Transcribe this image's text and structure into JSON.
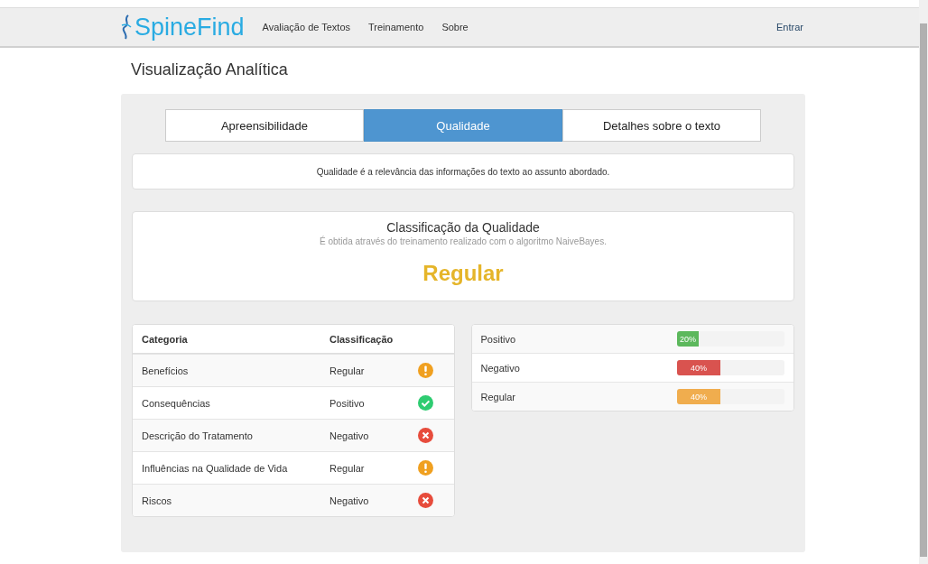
{
  "navbar": {
    "brand": "SpineFind",
    "links": [
      {
        "label": "Avaliação de Textos"
      },
      {
        "label": "Treinamento"
      },
      {
        "label": "Sobre"
      }
    ],
    "login": "Entrar"
  },
  "page_title": "Visualização Analítica",
  "tabs": [
    {
      "label": "Apreensibilidade",
      "selected": false
    },
    {
      "label": "Qualidade",
      "selected": true
    },
    {
      "label": "Detalhes sobre o texto",
      "selected": false
    }
  ],
  "description": "Qualidade é a relevância das informações do texto ao assunto abordado.",
  "classification": {
    "title": "Classificação da Qualidade",
    "subtitle": "É obtida através do treinamento realizado com o algoritmo NaiveBayes.",
    "result": "Regular"
  },
  "table": {
    "columns": [
      "Categoria",
      "Classificação"
    ],
    "rows": [
      {
        "category": "Benefícios",
        "classification": "Regular",
        "kind": "warning"
      },
      {
        "category": "Consequências",
        "classification": "Positivo",
        "kind": "success"
      },
      {
        "category": "Descrição do Tratamento",
        "classification": "Negativo",
        "kind": "error"
      },
      {
        "category": "Influências na Qualidade de Vida",
        "classification": "Regular",
        "kind": "warning"
      },
      {
        "category": "Riscos",
        "classification": "Negativo",
        "kind": "error"
      }
    ]
  },
  "distribution": [
    {
      "label": "Positivo",
      "level": 0.2,
      "reading": "20%",
      "color": "#5cb85c"
    },
    {
      "label": "Negativo",
      "level": 0.4,
      "reading": "40%",
      "color": "#d9534f"
    },
    {
      "label": "Regular",
      "level": 0.4,
      "reading": "40%",
      "color": "#f0ad4e"
    }
  ]
}
